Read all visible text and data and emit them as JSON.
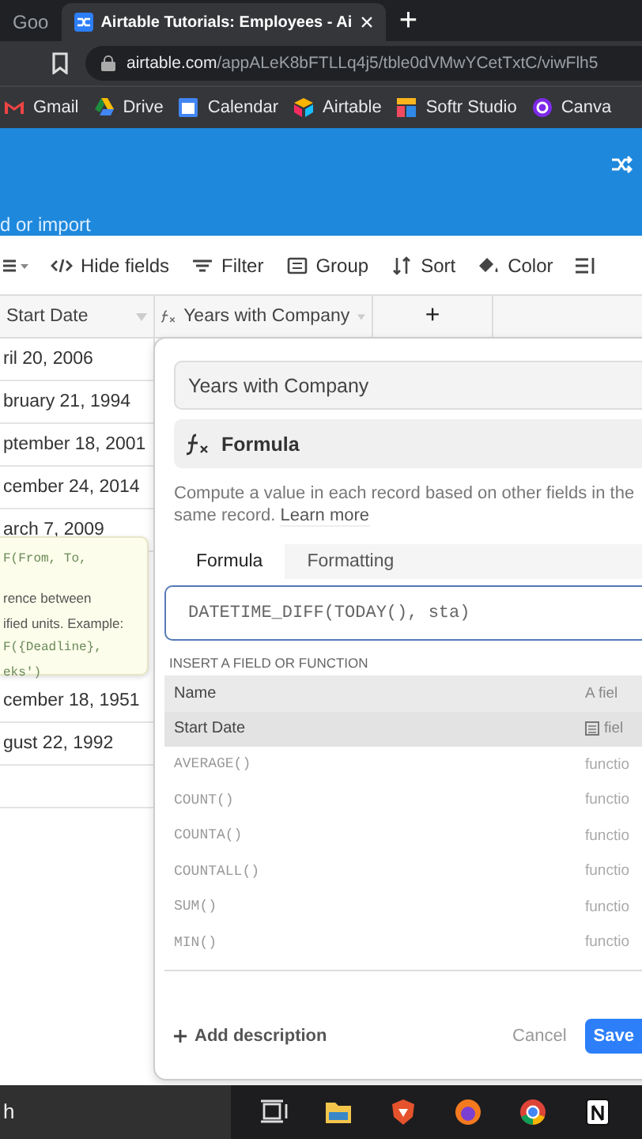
{
  "browser": {
    "tabs": [
      {
        "title": "Goo",
        "selected": false
      },
      {
        "title": "Airtable Tutorials: Employees - Ai",
        "selected": true
      }
    ],
    "close": "×",
    "new_tab": "+",
    "url_host": "airtable.com",
    "url_path": "/appALeK8bFTLLq4j5/tble0dVMwYCetTxtC/viwFlh5",
    "bookmarks": [
      "Gmail",
      "Drive",
      "Calendar",
      "Airtable",
      "Softr Studio",
      "Canva"
    ]
  },
  "header": {
    "link": "d or import"
  },
  "toolbar": [
    "Hide fields",
    "Filter",
    "Group",
    "Sort",
    "Color"
  ],
  "columns": [
    {
      "label": "Start Date"
    },
    {
      "label": "Years with Company"
    },
    {
      "label": "+"
    }
  ],
  "rows": [
    "ril 20, 2006",
    "bruary 21, 1994",
    "ptember 18, 2001",
    "cember 24, 2014",
    "arch 7, 2009",
    "cember 18, 1951",
    "gust 22, 1992"
  ],
  "tooltip": {
    "lines": [
      {
        "text": "F(From, To,",
        "kind": "code"
      },
      {
        "text": "rence between",
        "kind": "text"
      },
      {
        "text": "ified units. Example:",
        "kind": "text"
      },
      {
        "text": "F({Deadline},",
        "kind": "code"
      },
      {
        "text": "eks')",
        "kind": "code"
      }
    ]
  },
  "dialog": {
    "name": "Years with Company",
    "type": "Formula",
    "description": "Compute a value in each record based on other fields in the same record.",
    "learn_more": "Learn more",
    "tabs": [
      {
        "label": "Formula",
        "selected": true
      },
      {
        "label": "Formatting",
        "selected": false
      }
    ],
    "formula": "DATETIME_DIFF(TODAY(), sta)",
    "insert_label": "INSERT A FIELD OR FUNCTION",
    "list_header": {
      "name": "Name",
      "type": "A fiel"
    },
    "items": [
      {
        "name": "Start Date",
        "type": "fiel",
        "kind": "field",
        "selected": true
      },
      {
        "name": "AVERAGE()",
        "type": "functio",
        "kind": "function",
        "selected": false
      },
      {
        "name": "COUNT()",
        "type": "functio",
        "kind": "function",
        "selected": false
      },
      {
        "name": "COUNTA()",
        "type": "functio",
        "kind": "function",
        "selected": false
      },
      {
        "name": "COUNTALL()",
        "type": "functio",
        "kind": "function",
        "selected": false
      },
      {
        "name": "SUM()",
        "type": "functio",
        "kind": "function",
        "selected": false
      },
      {
        "name": "MIN()",
        "type": "functio",
        "kind": "function",
        "selected": false
      }
    ],
    "add_description": "Add description",
    "cancel": "Cancel",
    "save": "Save"
  },
  "taskbar": {
    "search": "h"
  }
}
